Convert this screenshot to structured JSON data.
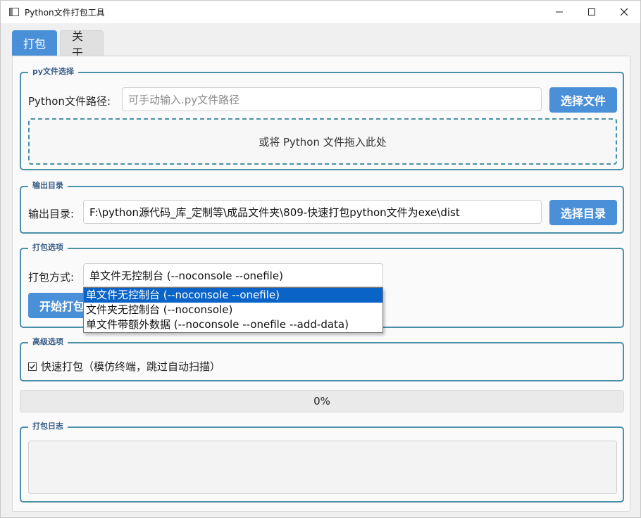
{
  "window": {
    "title": "Python文件打包工具",
    "controls": {
      "minimize": "—",
      "maximize": "☐",
      "close": "✕"
    }
  },
  "tabs": [
    {
      "label": "打包",
      "active": true
    },
    {
      "label": "关于",
      "active": false
    }
  ],
  "py_group": {
    "title": "py文件选择",
    "path_label": "Python文件路径:",
    "path_placeholder": "可手动输入.py文件路径",
    "path_value": "",
    "select_button": "选择文件",
    "drop_text": "或将 Python 文件拖入此处"
  },
  "output_group": {
    "title": "输出目录",
    "label": "输出目录:",
    "value": "F:\\python源代码_库_定制等\\成品文件夹\\809-快速打包python文件为exe\\dist",
    "select_button": "选择目录"
  },
  "pack_group": {
    "title": "打包选项",
    "mode_label": "打包方式:",
    "selected": "单文件无控制台 (--noconsole --onefile)",
    "options": [
      "单文件无控制台 (--noconsole --onefile)",
      "文件夹无控制台 (--noconsole)",
      "单文件带额外数据 (--noconsole --onefile --add-data)"
    ],
    "start_button": "开始打包"
  },
  "advanced_group": {
    "title": "高级选项",
    "fast_pack_label": "快速打包（模仿终端，跳过自动扫描）",
    "fast_pack_checked": true
  },
  "progress": {
    "text": "0%",
    "value": 0
  },
  "log_group": {
    "title": "打包日志",
    "content": ""
  },
  "colors": {
    "accent": "#4a90d9",
    "group_border": "#4a90a8",
    "selection": "#0a64c8"
  }
}
